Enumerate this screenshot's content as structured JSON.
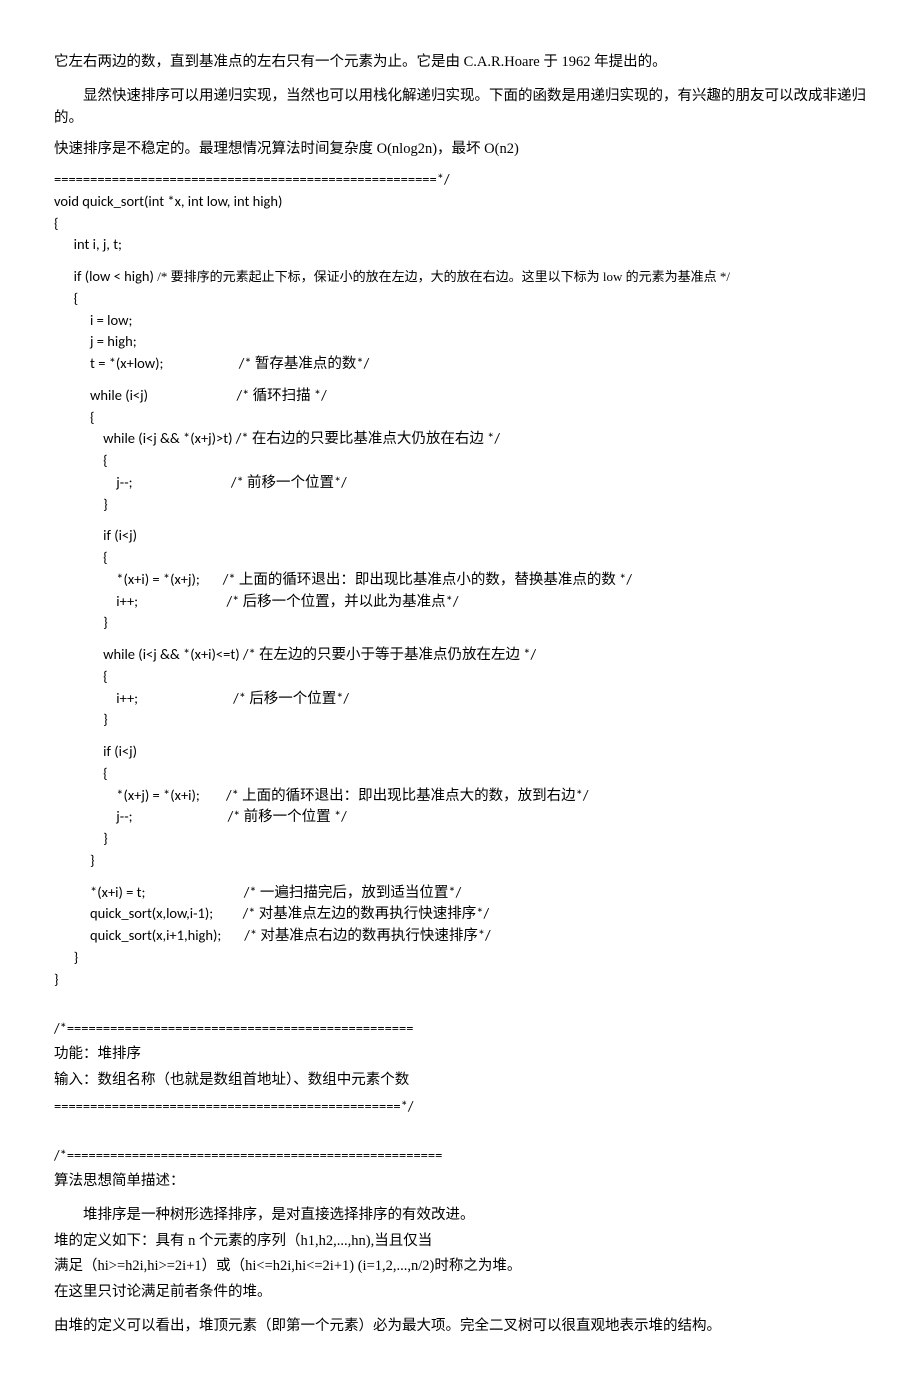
{
  "p1": " 它左右两边的数，直到基准点的左右只有一个元素为止。它是由 C.A.R.Hoare 于 1962 年提出的。",
  "p2": "显然快速排序可以用递归实现，当然也可以用栈化解递归实现。下面的函数是用递归实现的，有兴趣的朋友可以改成非递归的。",
  "p3": " 快速排序是不稳定的。最理想情况算法时间复杂度 O(nlog2n)，最坏 O(n2)",
  "code1_l1": "=====================================================*/",
  "code1_l2": "void quick_sort(int *x, int low, int high)",
  "code1_l3": "{",
  "code1_l4": "      int i, j, t;",
  "code1_l5": "      if (low < high) ",
  "code1_l5c": "/* 要排序的元素起止下标，保证小的放在左边，大的放在右边。这里以下标为 low 的元素为基准点 */",
  "code1_l6": "      {",
  "code1_l7": "           i = low;",
  "code1_l8": "           j = high;",
  "code1_l9": "           t = *(x+low);                       /* 暂存基准点的数*/",
  "code1_l10": "           while (i<j)                           /* 循环扫描 */",
  "code1_l11": "           {",
  "code1_l12": "               while (i<j && *(x+j)>t) /* 在右边的只要比基准点大仍放在右边 */",
  "code1_l13": "               {",
  "code1_l14": "                   j--;                              /* 前移一个位置*/",
  "code1_l15": "               }",
  "code1_l16": "               if (i<j)",
  "code1_l17": "               {",
  "code1_l18": "                   *(x+i) = *(x+j);       /* 上面的循环退出：即出现比基准点小的数，替换基准点的数 */",
  "code1_l19": "                   i++;                           /* 后移一个位置，并以此为基准点*/",
  "code1_l20": "               }",
  "code1_l21": "               while (i<j && *(x+i)<=t) /* 在左边的只要小于等于基准点仍放在左边 */",
  "code1_l22": "               {",
  "code1_l23": "                   i++;                             /* 后移一个位置*/",
  "code1_l24": "               }",
  "code1_l25": "               if (i<j)",
  "code1_l26": "               {",
  "code1_l27": "                   *(x+j) = *(x+i);        /* 上面的循环退出：即出现比基准点大的数，放到右边*/",
  "code1_l28": "                   j--;                             /* 前移一个位置 */",
  "code1_l29": "               }",
  "code1_l30": "           }",
  "code1_l31": "           *(x+i) = t;                              /* 一遍扫描完后，放到适当位置*/",
  "code1_l32": "           quick_sort(x,low,i-1);         /* 对基准点左边的数再执行快速排序*/",
  "code1_l33": "           quick_sort(x,i+1,high);       /* 对基准点右边的数再执行快速排序*/",
  "code1_l34": "      }",
  "code1_l35": "}",
  "block2_l1": "/*================================================",
  "block2_l2": " 功能：堆排序",
  "block2_l3": " 输入：数组名称（也就是数组首地址）、数组中元素个数",
  "block2_l4": "================================================*/",
  "block3_l1": "/*====================================================",
  "block3_l2": "算法思想简单描述：",
  "p4": "堆排序是一种树形选择排序，是对直接选择排序的有效改进。",
  "p5": " 堆的定义如下：具有 n 个元素的序列（h1,h2,...,hn),当且仅当",
  "p6": " 满足（hi>=h2i,hi>=2i+1）或（hi<=h2i,hi<=2i+1) (i=1,2,...,n/2)时称之为堆。",
  "p7": " 在这里只讨论满足前者条件的堆。",
  "p8": " 由堆的定义可以看出，堆顶元素（即第一个元素）必为最大项。完全二叉树可以很直观地表示堆的结构。"
}
